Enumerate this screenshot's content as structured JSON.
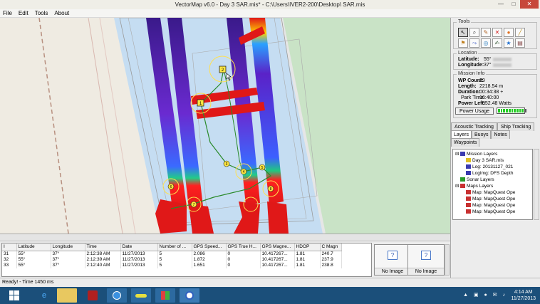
{
  "window": {
    "title": "VectorMap v6.0 - Day 3 SAR.mis* - C:\\Users\\IVER2-200\\Desktop\\ SAR.mis",
    "min": "—",
    "max": "□",
    "close": "✕"
  },
  "menu": [
    "File",
    "Edit",
    "Tools",
    "About"
  ],
  "tools": {
    "title": "Tools",
    "icons": [
      "cursor-icon",
      "zoom-icon",
      "pencil-icon",
      "delete-icon",
      "stop-icon",
      "ruler-icon",
      "waypoint-icon",
      "route-icon",
      "target-icon",
      "edit-icon",
      "marker-icon",
      "save-icon"
    ],
    "glyphs": [
      "↖",
      "⌕",
      "✎",
      "✕",
      "●",
      "╱",
      "⚑",
      "⤳",
      "◎",
      "✍",
      "★",
      "▤"
    ]
  },
  "location": {
    "title": "Location",
    "latitude_label": "Latitude:",
    "latitude_value": "55°",
    "longitude_label": "Longitude:",
    "longitude_value": "37°"
  },
  "mission": {
    "title": "Mission Info",
    "wp_label": "WP Count:",
    "wp_value": "29",
    "length_label": "Length:",
    "length_value": "2218.54 m",
    "duration_label": "Duration:",
    "duration_value": "00:34:38 +",
    "park_label": "Park Time:",
    "park_value": "16:40:00",
    "power_label": "Power Left:",
    "power_value": "552.48 Watts",
    "power_button": "Power Usage",
    "battery_level": 1.0
  },
  "tabs_row1": [
    "Acoustic Tracking",
    "Ship Tracking"
  ],
  "tabs_row2": [
    "Layers",
    "Buoys",
    "Notes"
  ],
  "tabs_row3": [
    "Waypoints"
  ],
  "layers": [
    {
      "label": "Mission Layers",
      "indent": 0,
      "color": "#3a3ab0",
      "exp": "⊟"
    },
    {
      "label": "Day 3 SAR.mis",
      "indent": 1,
      "color": "#e0c020",
      "exp": ""
    },
    {
      "label": "Log: 20131127_021",
      "indent": 1,
      "color": "#3a3ab0",
      "exp": ""
    },
    {
      "label": "LogImg: DFS Depth",
      "indent": 1,
      "color": "#3a3ab0",
      "exp": ""
    },
    {
      "label": "Sonar Layers",
      "indent": 0,
      "color": "#2a9a2a",
      "exp": ""
    },
    {
      "label": "Maps Layers",
      "indent": 0,
      "color": "#c83030",
      "exp": "⊟"
    },
    {
      "label": "Map: MapQuest Ope",
      "indent": 1,
      "color": "#c83030",
      "exp": ""
    },
    {
      "label": "Map: MapQuest Ope",
      "indent": 1,
      "color": "#c83030",
      "exp": ""
    },
    {
      "label": "Map: MapQuest Ope",
      "indent": 1,
      "color": "#c83030",
      "exp": ""
    },
    {
      "label": "Map: MapQuest Ope",
      "indent": 1,
      "color": "#c83030",
      "exp": ""
    }
  ],
  "table": {
    "columns": [
      "I",
      "Latitude",
      "Longitude",
      "Time",
      "Date",
      "Number of ...",
      "GPS Speed...",
      "GPS True H...",
      "GPS Magne...",
      "HDOP",
      "C Magn"
    ],
    "rows": [
      [
        "31",
        "55°",
        "37°",
        "2:12:38 AM",
        "11/27/2013",
        "5",
        "2.086",
        "0",
        "10.417267...",
        "1.81",
        "240.7"
      ],
      [
        "32",
        "55°",
        "37°",
        "2:12:39 AM",
        "11/27/2013",
        "5",
        "1.872",
        "0",
        "10.417267...",
        "1.81",
        "237.9"
      ],
      [
        "33",
        "55°",
        "37°",
        "2:12:40 AM",
        "11/27/2013",
        "5",
        "1.651",
        "0",
        "10.417267...",
        "1.81",
        "238.8"
      ]
    ]
  },
  "images": [
    {
      "label": "No Image",
      "icon": "?"
    },
    {
      "label": "No Image",
      "icon": "?"
    }
  ],
  "status": "Ready! - Time 1450 ms",
  "waypoint_labels": [
    "1",
    "2",
    "3",
    "4",
    "5",
    "6",
    "7",
    "8"
  ],
  "taskbar": {
    "time": "4:14 AM",
    "date": "11/27/2013",
    "tray": "▲ ▣ ● ✉ ♪"
  }
}
